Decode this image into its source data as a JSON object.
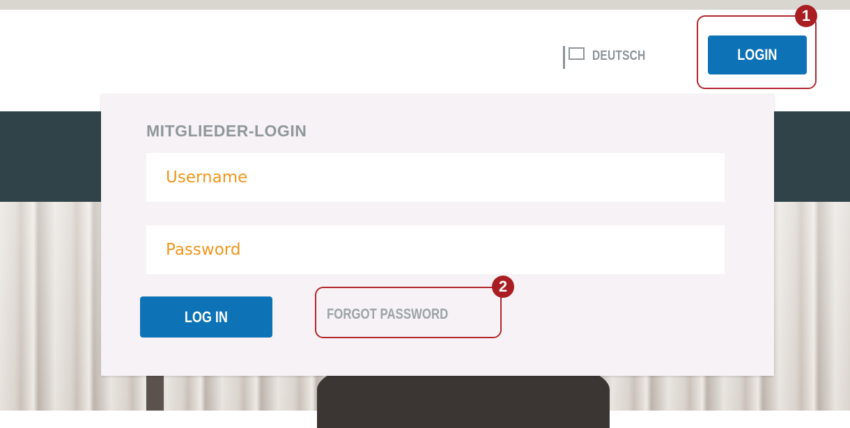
{
  "header": {
    "language_label": "DEUTSCH",
    "language_icon": "flag-icon",
    "login_label": "LOGIN"
  },
  "login_panel": {
    "title": "MITGLIEDER-LOGIN",
    "username_placeholder": "Username",
    "password_placeholder": "Password",
    "submit_label": "LOG IN",
    "forgot_label": "FORGOT PASSWORD"
  },
  "annotations": {
    "badge_1": "1",
    "badge_2": "2"
  },
  "colors": {
    "primary_blue": "#0d72b6",
    "placeholder_orange": "#f2951b",
    "highlight_red": "#b2262d",
    "dark_band": "#2f4349"
  }
}
